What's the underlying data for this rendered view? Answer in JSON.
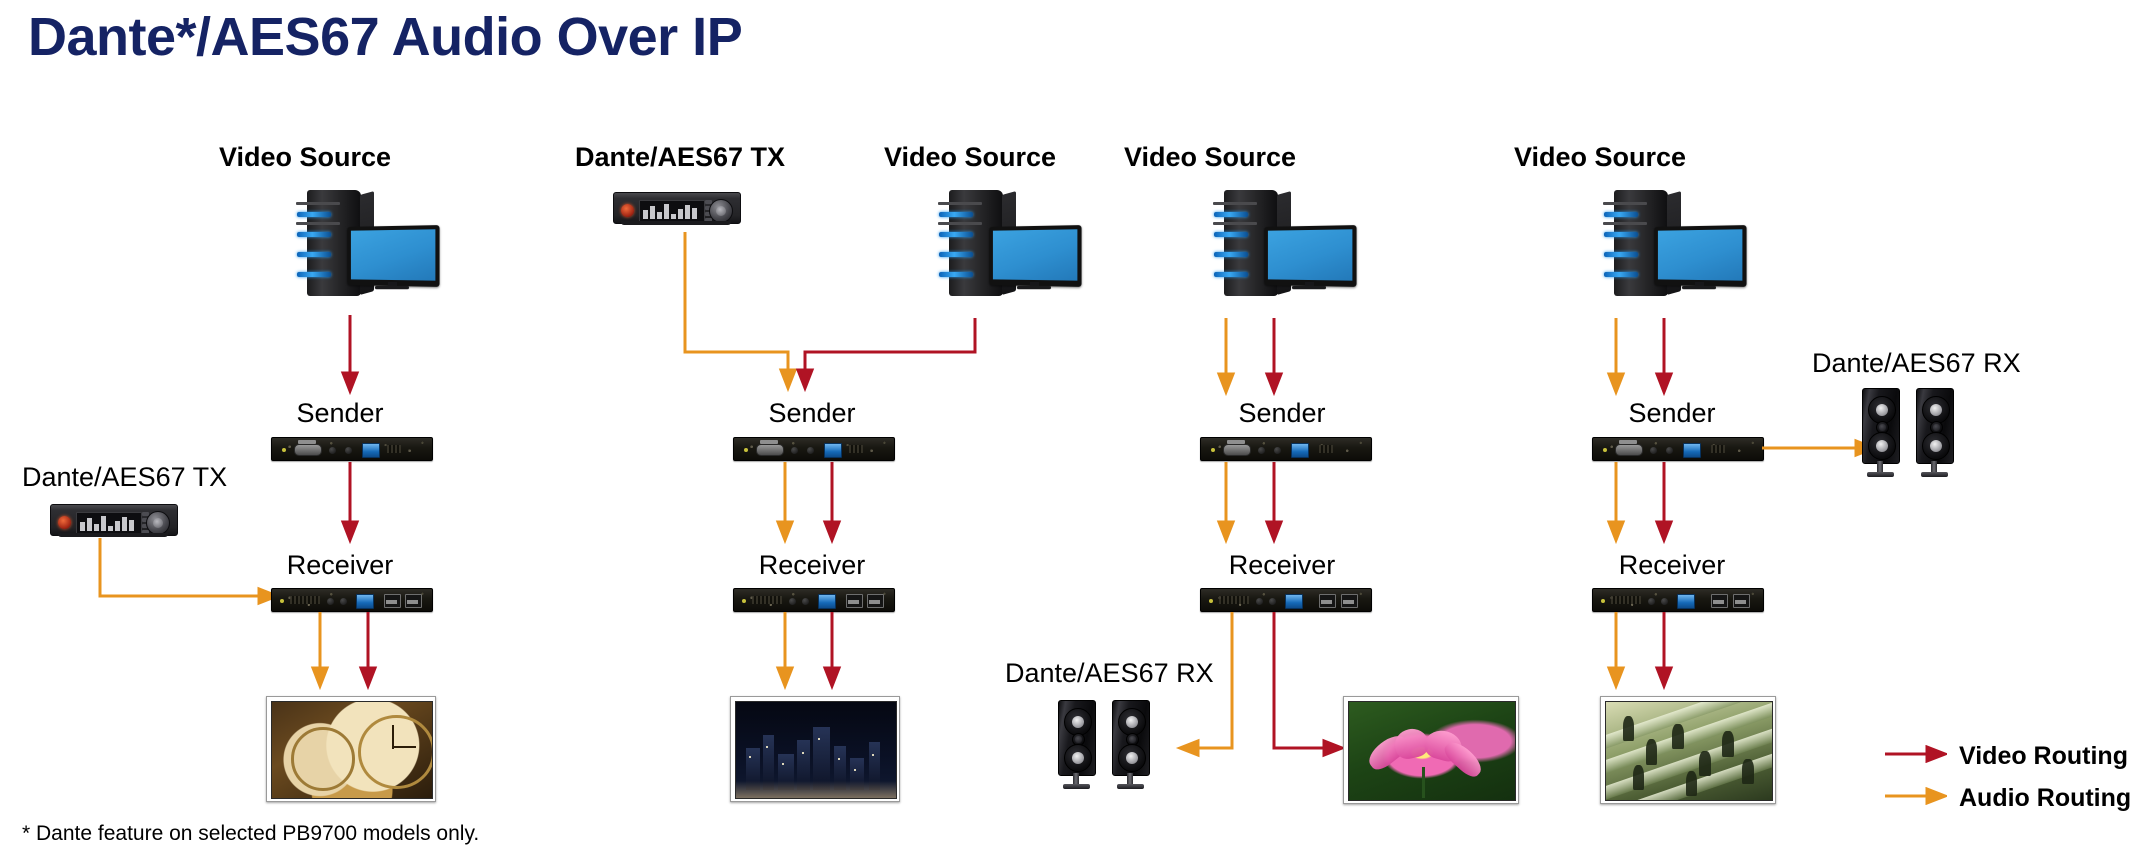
{
  "title": "Dante*/AES67 Audio Over IP",
  "footnote": "*  Dante feature on selected PB9700 models only.",
  "colors": {
    "title_navy": "#152364",
    "video_routing_red": "#b01324",
    "audio_routing_orange": "#e8941f",
    "background": "#ffffff"
  },
  "legend": {
    "items": [
      {
        "label": "Video Routing",
        "color": "#b01324",
        "icon": "arrow-right-icon"
      },
      {
        "label": "Audio Routing",
        "color": "#e8941f",
        "icon": "arrow-right-icon"
      }
    ]
  },
  "labels": {
    "video_source": "Video Source",
    "dante_tx": "Dante/AES67 TX",
    "dante_rx": "Dante/AES67 RX",
    "sender": "Sender",
    "receiver": "Receiver"
  },
  "columns": [
    {
      "id": "col-1",
      "header": "Video Source",
      "header_bold": true,
      "side_label": "Dante/AES67 TX",
      "side_label_bold": false,
      "sender": "Sender",
      "receiver": "Receiver",
      "display": "clocks",
      "inputs": [
        "video-red-down",
        "audio-orange-from-left"
      ],
      "outputs": [
        "video-red-down-to-display",
        "audio-orange-down-to-display"
      ]
    },
    {
      "id": "col-2",
      "header": "Dante/AES67 TX",
      "header_bold": true,
      "header_2": "Video Source",
      "sender": "Sender",
      "receiver": "Receiver",
      "display": "city-night",
      "inputs": [
        "audio-orange-elbow-right",
        "video-red-elbow-left"
      ],
      "outputs": [
        "video-red-down-to-display",
        "audio-orange-down-to-display"
      ]
    },
    {
      "id": "col-3",
      "header": "Video Source",
      "header_bold": true,
      "sender": "Sender",
      "receiver": "Receiver",
      "side_label": "Dante/AES67 RX",
      "side_label_bold": false,
      "display": "lotus-flower",
      "speakers": true,
      "outputs": [
        "audio-orange-elbow-left-to-speakers",
        "video-red-elbow-right-to-display"
      ]
    },
    {
      "id": "col-4",
      "header": "Video Source",
      "header_bold": true,
      "sender": "Sender",
      "receiver": "Receiver",
      "side_label": "Dante/AES67 RX",
      "side_label_bold": false,
      "display": "escalator-crowd",
      "speakers": true,
      "outputs": [
        "audio-orange-right-to-speakers",
        "video-red-down-to-display"
      ]
    }
  ],
  "devices": {
    "dante_tx_icon": "audio-interface-icon",
    "dante_rx_icon": "speaker-pair-icon",
    "video_source_icon": "pc-tower-monitor-icon",
    "sender_icon": "rack-unit-sender-icon",
    "receiver_icon": "rack-unit-receiver-icon"
  }
}
